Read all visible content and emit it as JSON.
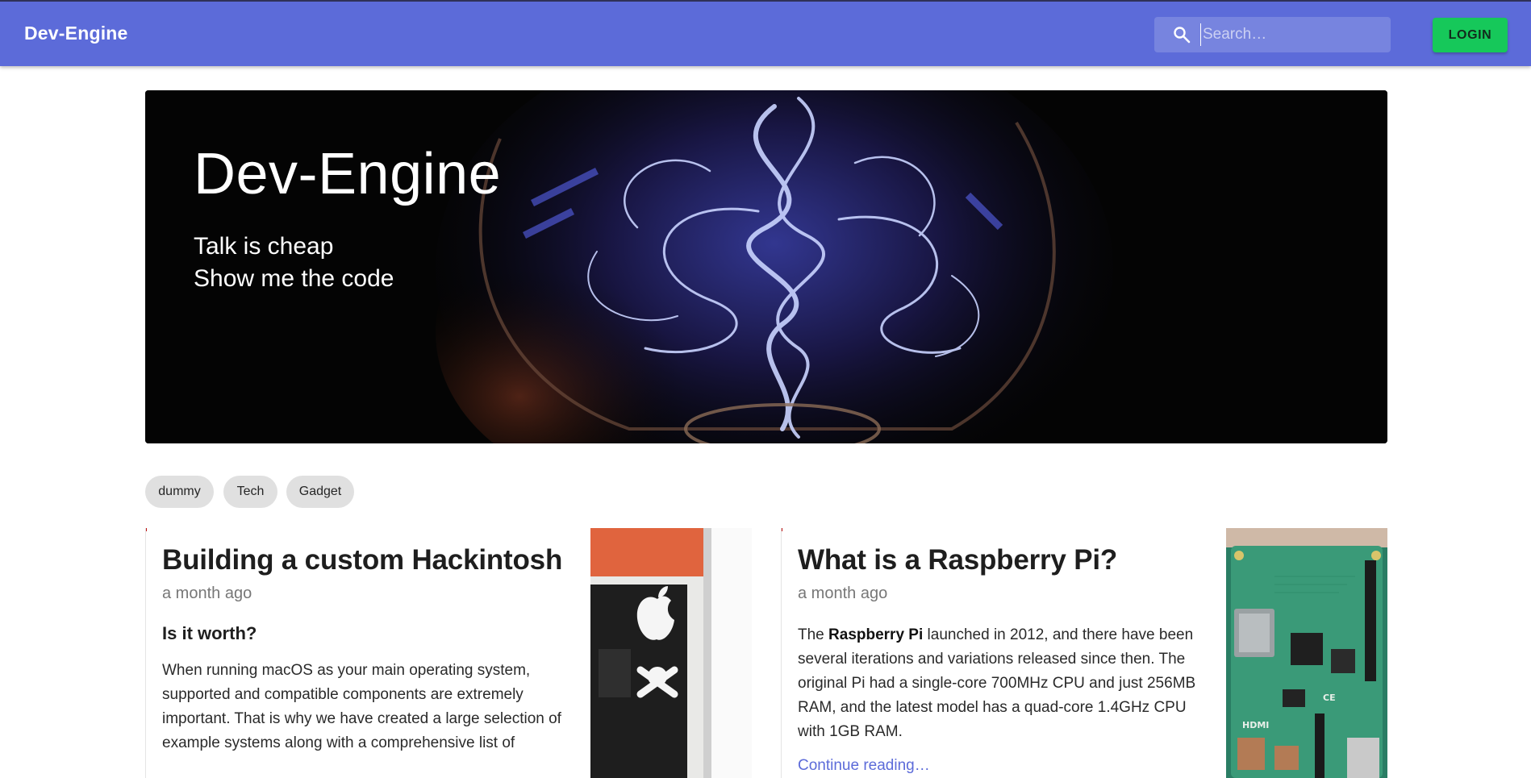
{
  "appbar": {
    "brand": "Dev-Engine",
    "search_placeholder": "Search…",
    "login_label": "LOGIN",
    "color": "#5c6bd9"
  },
  "hero": {
    "title": "Dev-Engine",
    "line1": "Talk is cheap",
    "line2": "Show me the code"
  },
  "chips": [
    "dummy",
    "Tech",
    "Gadget"
  ],
  "posts": [
    {
      "title": "Building a custom Hackintosh",
      "date": "a month ago",
      "subtitle": "Is it worth?",
      "body": "When running macOS as your main operating system, supported and compatible components are extremely important. That is why we have created a large selection of example systems along with a comprehensive list of"
    },
    {
      "title": "What is a Raspberry Pi?",
      "date": "a month ago",
      "body_bold": "Raspberry Pi",
      "body_pre": "The ",
      "body_post": " launched in 2012, and there have been several iterations and variations released since then. The original Pi had a single-core 700MHz CPU and just 256MB RAM, and the latest model has a quad-core 1.4GHz CPU with 1GB RAM.",
      "more": "Continue reading…"
    }
  ],
  "colors": {
    "login": "#16c85a",
    "chip": "#e0e0e0",
    "link": "#5c6bd9"
  }
}
